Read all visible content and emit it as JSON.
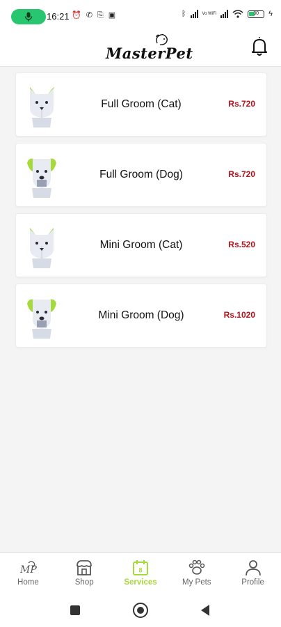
{
  "status_bar": {
    "time": "16:21",
    "volte_label": "Vo WiFi",
    "battery_level": "30",
    "accent_green": "#28c76f"
  },
  "app": {
    "logo_text": "MasterPet"
  },
  "services": [
    {
      "name": "Full Groom (Cat)",
      "price": "Rs.720",
      "pet": "cat"
    },
    {
      "name": "Full Groom (Dog)",
      "price": "Rs.720",
      "pet": "dog"
    },
    {
      "name": "Mini Groom (Cat)",
      "price": "Rs.520",
      "pet": "cat"
    },
    {
      "name": "Mini Groom (Dog)",
      "price": "Rs.1020",
      "pet": "dog"
    }
  ],
  "bottom_nav": {
    "items": [
      {
        "label": "Home",
        "icon": "home-logo-icon",
        "active": false
      },
      {
        "label": "Shop",
        "icon": "shop-icon",
        "active": false
      },
      {
        "label": "Services",
        "icon": "services-calendar-icon",
        "active": true
      },
      {
        "label": "My Pets",
        "icon": "paw-icon",
        "active": false
      },
      {
        "label": "Profile",
        "icon": "user-icon",
        "active": false
      }
    ]
  },
  "colors": {
    "price_red": "#b5121b",
    "active_green": "#a6d93b",
    "background": "#f4f4f4"
  }
}
